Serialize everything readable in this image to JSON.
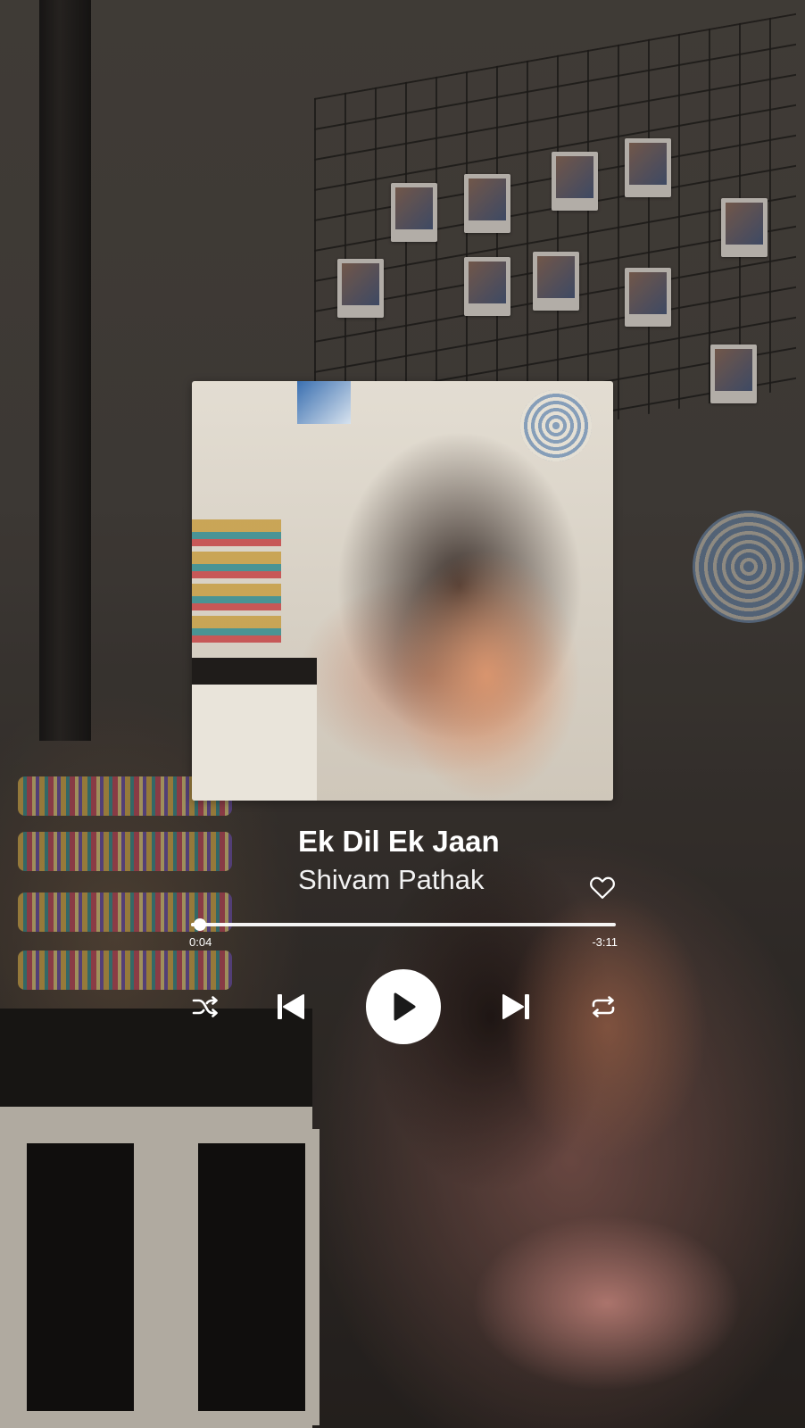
{
  "player": {
    "track_title": "Ek Dil Ek Jaan",
    "artist": "Shivam Pathak",
    "elapsed": "0:04",
    "remaining": "-3:11",
    "progress_fraction": 0.02,
    "is_liked": false,
    "is_playing": false
  },
  "icons": {
    "like": "heart-outline-icon",
    "shuffle": "shuffle-icon",
    "previous": "skip-previous-icon",
    "play": "play-icon",
    "next": "skip-next-icon",
    "repeat": "repeat-icon"
  },
  "colors": {
    "foreground": "#ffffff",
    "play_icon": "#1a1a1a"
  }
}
